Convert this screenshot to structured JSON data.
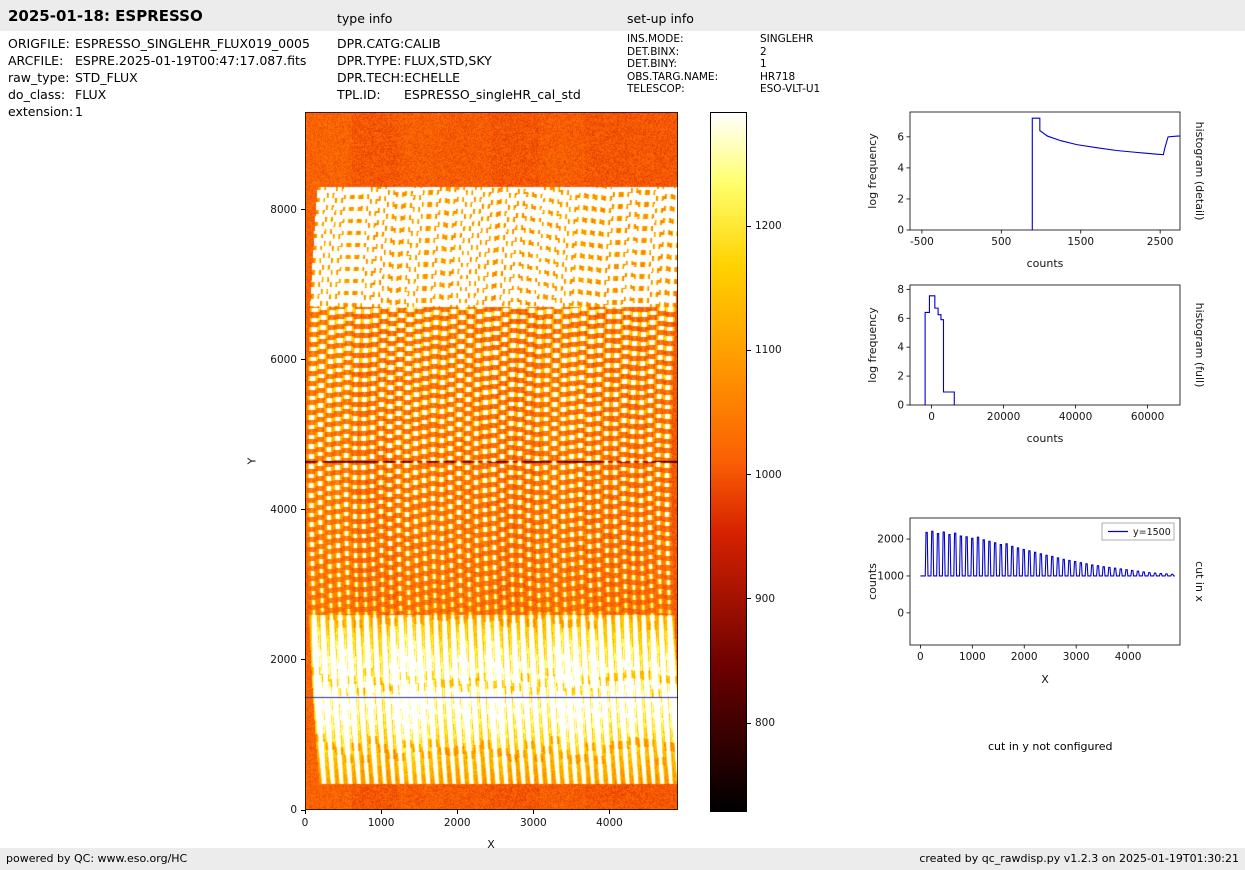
{
  "header": {
    "title": "2025-01-18: ESPRESSO",
    "type_info_label": "type info",
    "setup_info_label": "set-up info"
  },
  "file_info": [
    {
      "label": "ORIGFILE:",
      "value": "ESPRESSO_SINGLEHR_FLUX019_0005"
    },
    {
      "label": "ARCFILE:",
      "value": "ESPRE.2025-01-19T00:47:17.087.fits"
    },
    {
      "label": "raw_type:",
      "value": "STD_FLUX"
    },
    {
      "label": "do_class:",
      "value": "FLUX"
    },
    {
      "label": "extension:",
      "value": "1"
    }
  ],
  "type_info": [
    {
      "label": "DPR.CATG:",
      "value": "CALIB"
    },
    {
      "label": "DPR.TYPE:",
      "value": "FLUX,STD,SKY"
    },
    {
      "label": "DPR.TECH:",
      "value": "ECHELLE"
    },
    {
      "label": "TPL.ID:",
      "value": "ESPRESSO_singleHR_cal_std"
    }
  ],
  "setup_info": [
    {
      "label": "INS.MODE:",
      "value": "SINGLEHR"
    },
    {
      "label": "DET.BINX:",
      "value": "2"
    },
    {
      "label": "DET.BINY:",
      "value": "1"
    },
    {
      "label": "OBS.TARG.NAME:",
      "value": "HR718"
    },
    {
      "label": "TELESCOP:",
      "value": "ESO-VLT-U1"
    }
  ],
  "notes": {
    "cut_in_y": "cut in y not configured"
  },
  "footer": {
    "left": "powered by QC: www.eso.org/HC",
    "right": "created by qc_rawdisp.py v1.2.3 on 2025-01-19T01:30:21"
  },
  "chart_data": [
    {
      "id": "raw-frame",
      "type": "heatmap",
      "description": "ESPRESSO raw echelle frame: vertical spectral orders on orange background, saturated white dashes near top, hot colormap",
      "xlabel": "X",
      "ylabel": "Y",
      "xlim": [
        0,
        4900
      ],
      "ylim": [
        0,
        9300
      ],
      "xticks": [
        0,
        1000,
        2000,
        3000,
        4000
      ],
      "yticks": [
        0,
        2000,
        4000,
        6000,
        8000
      ],
      "cut_line": {
        "y": 1500,
        "color": "#2d2dbe"
      },
      "dark_row_y": 4650,
      "orders": {
        "count": 42,
        "x_start": 130,
        "x_end": 4800,
        "solid_y": [
          350,
          2600
        ],
        "dashed_y": [
          2600,
          6700
        ],
        "bright_y": [
          6700,
          8300
        ]
      },
      "colorbar": {
        "vmin": 730,
        "vmax": 1292,
        "ticks": [
          800,
          900,
          1000,
          1100,
          1200
        ]
      }
    },
    {
      "id": "hist-detail",
      "type": "line",
      "right_label": "histogram (detail)",
      "xlabel": "counts",
      "ylabel": "log frequency",
      "xlim": [
        -650,
        2750
      ],
      "ylim": [
        0,
        7.6
      ],
      "xticks": [
        -500,
        500,
        1500,
        2500
      ],
      "yticks": [
        0,
        2,
        4,
        6
      ],
      "color": "#0000cc",
      "points": [
        [
          890,
          0
        ],
        [
          890,
          7.2
        ],
        [
          985,
          7.2
        ],
        [
          985,
          6.4
        ],
        [
          1080,
          6.05
        ],
        [
          1250,
          5.75
        ],
        [
          1450,
          5.5
        ],
        [
          1700,
          5.3
        ],
        [
          1950,
          5.12
        ],
        [
          2200,
          5.0
        ],
        [
          2420,
          4.9
        ],
        [
          2540,
          4.85
        ],
        [
          2560,
          5.3
        ],
        [
          2600,
          6.0
        ],
        [
          2720,
          6.05
        ],
        [
          2750,
          6.05
        ]
      ]
    },
    {
      "id": "hist-full",
      "type": "line",
      "right_label": "histogram (full)",
      "xlabel": "counts",
      "ylabel": "log frequency",
      "xlim": [
        -6000,
        69000
      ],
      "ylim": [
        0,
        8.3
      ],
      "xticks": [
        0,
        20000,
        40000,
        60000
      ],
      "yticks": [
        0,
        2,
        4,
        6,
        8
      ],
      "color": "#0000cc",
      "points": [
        [
          -1800,
          0
        ],
        [
          -1800,
          6.4
        ],
        [
          -600,
          6.4
        ],
        [
          -600,
          7.55
        ],
        [
          900,
          7.55
        ],
        [
          900,
          6.7
        ],
        [
          1800,
          6.7
        ],
        [
          1800,
          6.25
        ],
        [
          2600,
          6.25
        ],
        [
          2600,
          5.9
        ],
        [
          3300,
          5.9
        ],
        [
          3300,
          0.9
        ],
        [
          6300,
          0.9
        ],
        [
          6300,
          0
        ]
      ]
    },
    {
      "id": "cut-x",
      "type": "line",
      "right_label": "cut in x",
      "xlabel": "X",
      "ylabel": "counts",
      "xlim": [
        -200,
        5000
      ],
      "ylim": [
        -870,
        2570
      ],
      "xticks": [
        0,
        1000,
        2000,
        3000,
        4000
      ],
      "yticks": [
        0,
        1000,
        2000
      ],
      "color": "#0000cc",
      "legend": "y=1500",
      "baseline": 1000,
      "spikes": [
        [
          120,
          2180
        ],
        [
          230,
          2210
        ],
        [
          340,
          2150
        ],
        [
          450,
          2190
        ],
        [
          560,
          2120
        ],
        [
          670,
          2160
        ],
        [
          780,
          2080
        ],
        [
          890,
          2060
        ],
        [
          1000,
          2020
        ],
        [
          1110,
          2050
        ],
        [
          1220,
          1980
        ],
        [
          1330,
          1940
        ],
        [
          1440,
          1900
        ],
        [
          1550,
          1850
        ],
        [
          1660,
          1870
        ],
        [
          1770,
          1800
        ],
        [
          1880,
          1760
        ],
        [
          1990,
          1720
        ],
        [
          2100,
          1680
        ],
        [
          2210,
          1640
        ],
        [
          2320,
          1600
        ],
        [
          2430,
          1560
        ],
        [
          2540,
          1530
        ],
        [
          2650,
          1490
        ],
        [
          2760,
          1450
        ],
        [
          2870,
          1420
        ],
        [
          2980,
          1390
        ],
        [
          3090,
          1360
        ],
        [
          3200,
          1330
        ],
        [
          3310,
          1300
        ],
        [
          3420,
          1280
        ],
        [
          3530,
          1250
        ],
        [
          3640,
          1230
        ],
        [
          3750,
          1210
        ],
        [
          3860,
          1190
        ],
        [
          3970,
          1170
        ],
        [
          4080,
          1150
        ],
        [
          4190,
          1130
        ],
        [
          4300,
          1110
        ],
        [
          4410,
          1090
        ],
        [
          4520,
          1080
        ],
        [
          4630,
          1065
        ],
        [
          4740,
          1055
        ],
        [
          4850,
          1045
        ]
      ]
    }
  ]
}
